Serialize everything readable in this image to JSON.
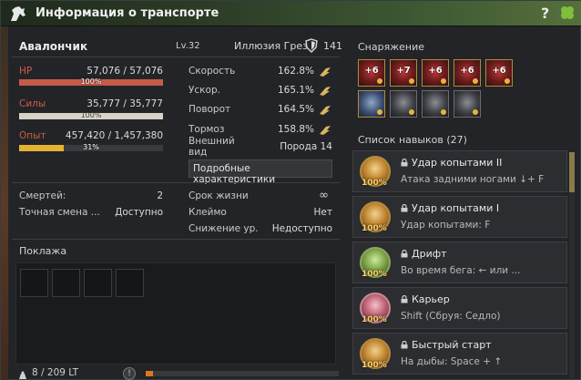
{
  "window": {
    "title": "Информация о транспорте",
    "help": "?"
  },
  "horse": {
    "name": "Авалончик",
    "level": "Lv.32",
    "illusion_label": "Иллюзия Грез",
    "illusion_value": "141"
  },
  "stats": {
    "hp": {
      "label": "HP",
      "value": "57,076 / 57,076",
      "pct_text": "100%",
      "fill": 1.0,
      "color": "#c85a4a"
    },
    "stamina": {
      "label": "Силы",
      "value": "35,777 / 35,777",
      "pct_text": "100%",
      "fill": 1.0,
      "color": "#d8d3c6"
    },
    "exp": {
      "label": "Опыт",
      "value": "457,420 / 1,457,380",
      "pct_text": "31%",
      "fill": 0.31,
      "color": "#e5b232"
    }
  },
  "attributes": [
    {
      "label": "Скорость",
      "value": "162.8%"
    },
    {
      "label": "Ускор.",
      "value": "165.1%"
    },
    {
      "label": "Поворот",
      "value": "164.5%"
    },
    {
      "label": "Тормоз",
      "value": "158.8%"
    }
  ],
  "appearance": {
    "label_1": "Внешний",
    "label_2": "вид",
    "value": "Порода 14"
  },
  "details_button": "Подробные характеристики",
  "misc_left": [
    {
      "label": "Смертей:",
      "value": "2"
    },
    {
      "label": "Точная смена ...",
      "value": "Доступно"
    }
  ],
  "misc_right": [
    {
      "label": "Срок жизни",
      "value": "∞"
    },
    {
      "label": "Клеймо",
      "value": "Нет"
    },
    {
      "label": "Снижение ур.",
      "value": "Недоступно"
    }
  ],
  "cargo": {
    "title": "Поклажа",
    "weight": "8 / 209 LT",
    "weight_fill": 0.04
  },
  "gear": {
    "title": "Снаряжение",
    "row1": [
      {
        "type": "red",
        "label": "+6"
      },
      {
        "type": "red",
        "label": "+7"
      },
      {
        "type": "red",
        "label": "+6"
      },
      {
        "type": "red",
        "label": "+6"
      },
      {
        "type": "red",
        "label": "+6"
      }
    ],
    "row2": [
      {
        "type": "blue"
      },
      {
        "type": "dark"
      },
      {
        "type": "dark"
      },
      {
        "type": "dark"
      }
    ]
  },
  "skills": {
    "title": "Список навыков (27)",
    "items": [
      {
        "name": "Удар копытами II",
        "desc": "Атака задними ногами ↓+ F",
        "pct": "100%",
        "icon": "gold"
      },
      {
        "name": "Удар копытами I",
        "desc": "Удар копытами: F",
        "pct": "100%",
        "icon": "gold"
      },
      {
        "name": "Дрифт",
        "desc": "Во время бега: ← или ...",
        "pct": "100%",
        "icon": "green"
      },
      {
        "name": "Карьер",
        "desc": "Shift (Сбруя: Седло)",
        "pct": "100%",
        "icon": "pink"
      },
      {
        "name": "Быстрый старт",
        "desc": "На дыбы: Space + ↑",
        "pct": "100%",
        "icon": "gold"
      }
    ]
  }
}
